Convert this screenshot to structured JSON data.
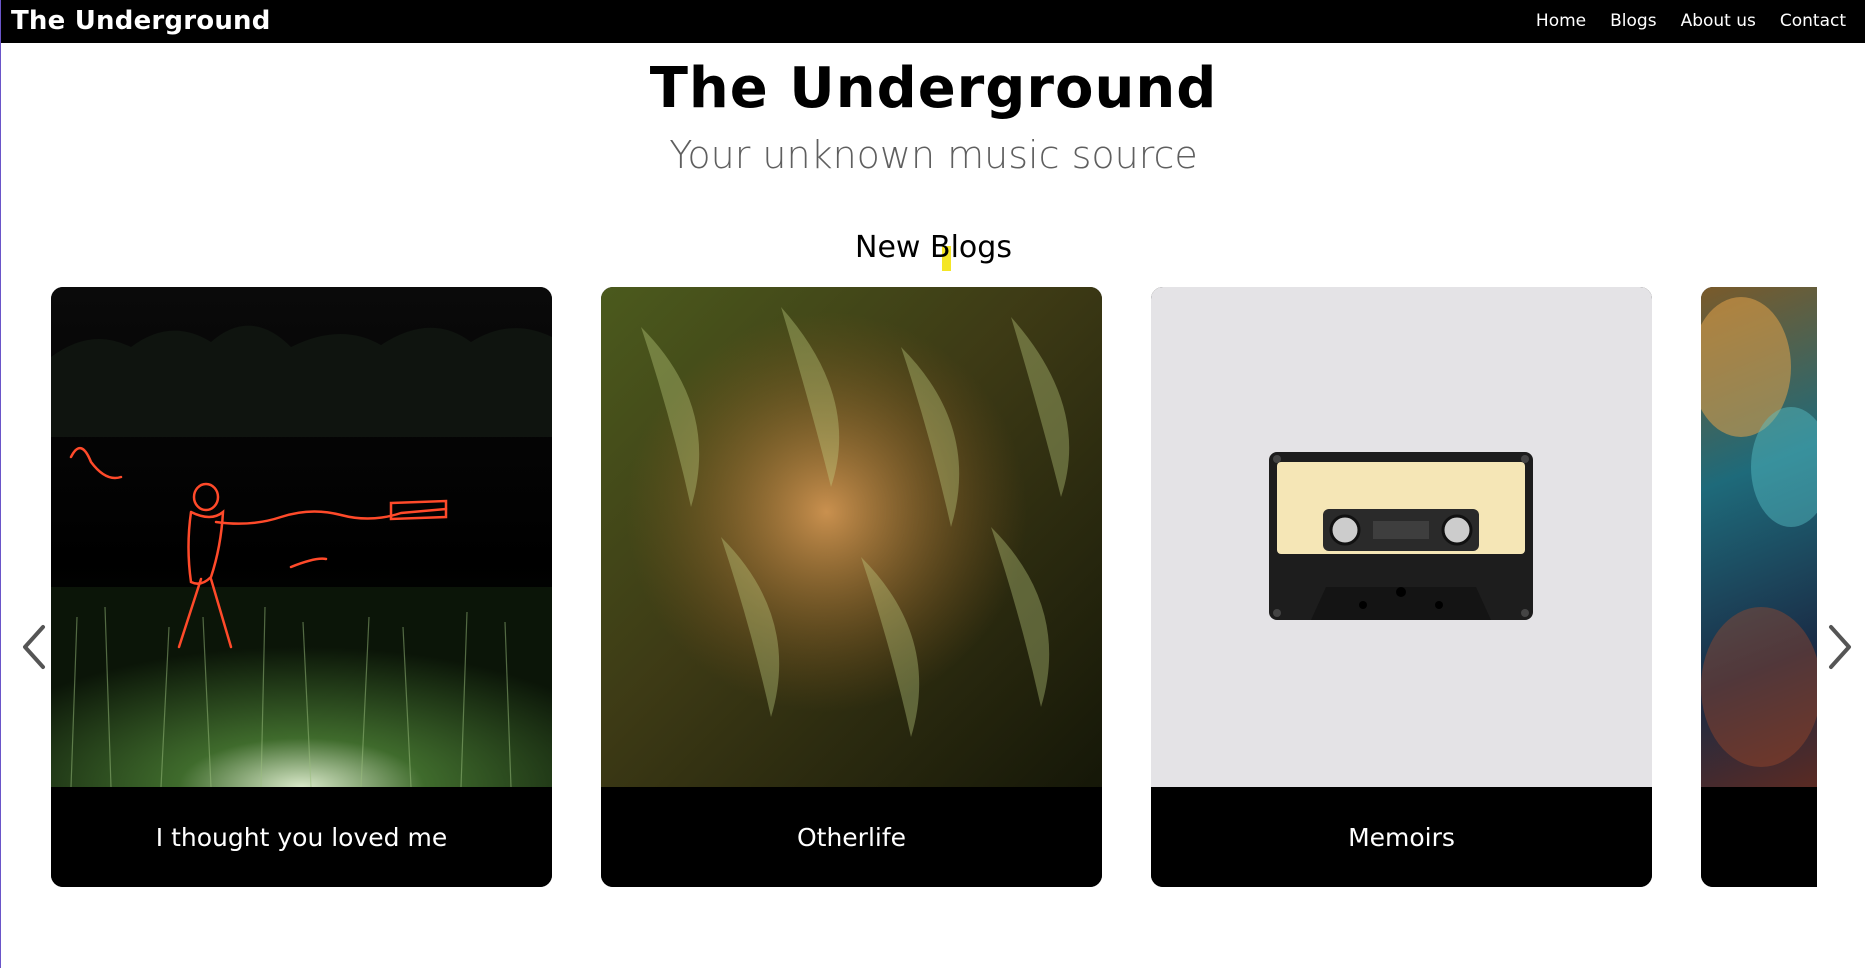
{
  "navbar": {
    "brand": "The Underground",
    "links": [
      "Home",
      "Blogs",
      "About us",
      "Contact"
    ]
  },
  "hero": {
    "title": "The Underground",
    "subtitle": "Your unknown music source"
  },
  "section": {
    "title": "New Blogs"
  },
  "carousel": {
    "prev_icon": "chevron-left-icon",
    "next_icon": "chevron-right-icon",
    "cards": [
      {
        "title": "I thought you loved me",
        "image": "light-painting-figure-image"
      },
      {
        "title": "Otherlife",
        "image": "green-light-streaks-image"
      },
      {
        "title": "Memoirs",
        "image": "cassette-tape-image"
      },
      {
        "title": "",
        "image": "nebula-image"
      }
    ]
  },
  "colors": {
    "navbar_bg": "#000000",
    "page_bg": "#ffffff",
    "caption_bg": "#000000",
    "subtitle": "#5f5f5f",
    "highlight": "#f2e200",
    "arrow": "#555555"
  }
}
